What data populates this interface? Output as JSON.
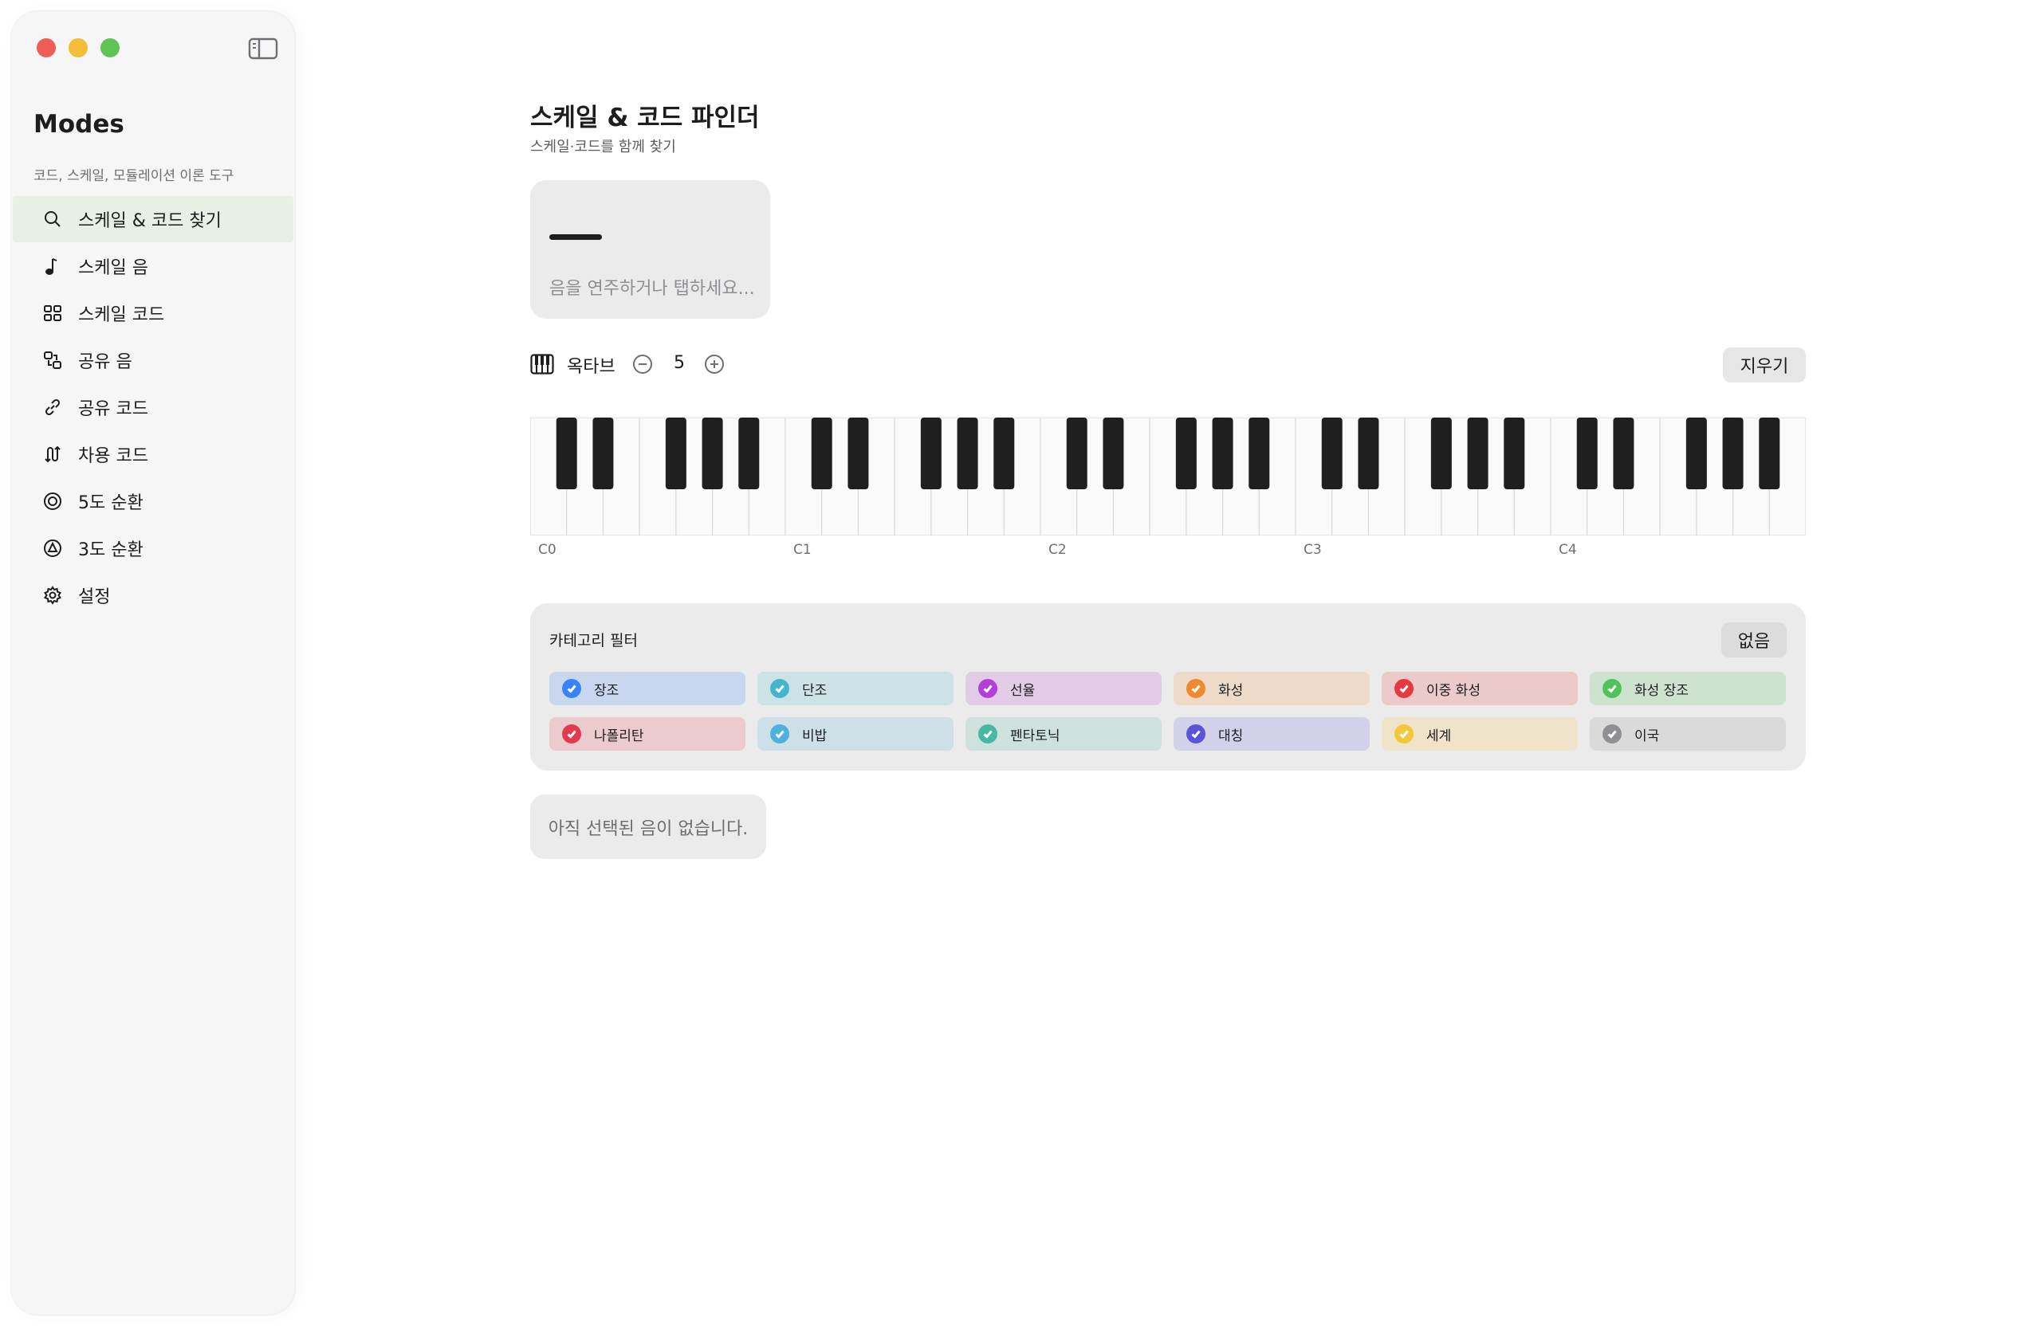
{
  "app": {
    "title": "Modes",
    "subtitle": "코드, 스케일, 모듈레이션 이론 도구"
  },
  "sidebar": {
    "items": [
      {
        "label": "스케일 & 코드 찾기",
        "icon": "search-icon",
        "active": true
      },
      {
        "label": "스케일 음",
        "icon": "music-note-icon",
        "active": false
      },
      {
        "label": "스케일 코드",
        "icon": "grid-icon",
        "active": false
      },
      {
        "label": "공유 음",
        "icon": "shared-notes-icon",
        "active": false
      },
      {
        "label": "공유 코드",
        "icon": "link-icon",
        "active": false
      },
      {
        "label": "차용 코드",
        "icon": "borrow-icon",
        "active": false
      },
      {
        "label": "5도 순환",
        "icon": "circle-icon",
        "active": false
      },
      {
        "label": "3도 순환",
        "icon": "triangle-circle-icon",
        "active": false
      },
      {
        "label": "설정",
        "icon": "gear-icon",
        "active": false
      }
    ]
  },
  "main": {
    "title": "스케일 & 코드 파인더",
    "subtitle": "스케일·코드를 함께 찾기",
    "note_hint": "음을 연주하거나 탭하세요...",
    "octave_label": "옥타브",
    "octave_value": "5",
    "clear_label": "지우기",
    "piano": {
      "octave_labels": [
        "C0",
        "C1",
        "C2",
        "C3",
        "C4"
      ],
      "white_keys": 35
    },
    "filter": {
      "title": "카테고리 필터",
      "none_label": "없음",
      "categories": [
        {
          "label": "장조",
          "color": "#3a82f7",
          "bg": "#c8d6ee"
        },
        {
          "label": "단조",
          "color": "#44b6cc",
          "bg": "#cde2e5"
        },
        {
          "label": "선율",
          "color": "#b43fd8",
          "bg": "#e2cbe7"
        },
        {
          "label": "화성",
          "color": "#ee8a2f",
          "bg": "#eedac9"
        },
        {
          "label": "이중 화성",
          "color": "#e5393f",
          "bg": "#eccaca"
        },
        {
          "label": "화성 장조",
          "color": "#4fc25a",
          "bg": "#cee3cd"
        },
        {
          "label": "나폴리탄",
          "color": "#e5394c",
          "bg": "#ebcbcd"
        },
        {
          "label": "비밥",
          "color": "#4fb0de",
          "bg": "#cddfe7"
        },
        {
          "label": "펜타토닉",
          "color": "#47b8a3",
          "bg": "#cde2dd"
        },
        {
          "label": "대칭",
          "color": "#5a55d8",
          "bg": "#d2d1e9"
        },
        {
          "label": "세계",
          "color": "#f2c83a",
          "bg": "#efe3c9"
        },
        {
          "label": "이국",
          "color": "#8e8e93",
          "bg": "#dadada"
        }
      ]
    },
    "empty_state": "아직 선택된 음이 없습니다."
  }
}
